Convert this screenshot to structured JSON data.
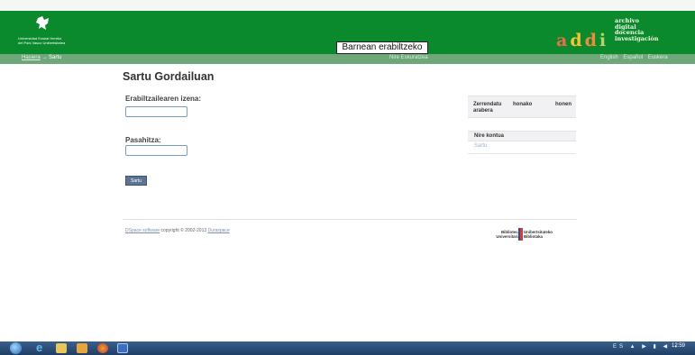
{
  "window": {
    "title": "Sartu Gordailuan"
  },
  "header": {
    "university_lines": [
      "Universidad  Euskal Herriko",
      "del País Vasco  Unibertsitatea"
    ],
    "internal_label": "Barnean erabiltzeko",
    "addi_letters": [
      "a",
      "d",
      "d",
      "i"
    ],
    "addi_desc": [
      "archivo",
      "digital",
      "docencia",
      "investigación"
    ]
  },
  "breadcrumb": {
    "home": "Hasiera",
    "separator": "→",
    "current": "Sartu"
  },
  "mybar": {
    "label": "Nire Eskuratzea"
  },
  "languages": [
    "English",
    "Español",
    "Euskera"
  ],
  "form": {
    "title": "Sartu Gordailuan",
    "username_label": "Erabiltzailearen izena:",
    "username_value": "",
    "password_label": "Pasahitza:",
    "password_value": "",
    "submit_label": "Sartu"
  },
  "sidebar": {
    "sort_words": [
      "Zerrendatu",
      "honako",
      "honen"
    ],
    "sort_second_line": "arabera",
    "account_heading": "Nire kontua",
    "account_login": "Sartu"
  },
  "footer": {
    "link1": "DSpace software",
    "text": " copyright © 2002-2013 ",
    "link2": "Duraspace",
    "library_left": [
      "Biblioteca",
      "Universitaria"
    ],
    "library_right": [
      "Unibertsitateko",
      "Bibliotaka"
    ]
  },
  "taskbar": {
    "clock": "12:59",
    "tray": "ES ▲ ▶ ▮ ◀ ◖"
  }
}
